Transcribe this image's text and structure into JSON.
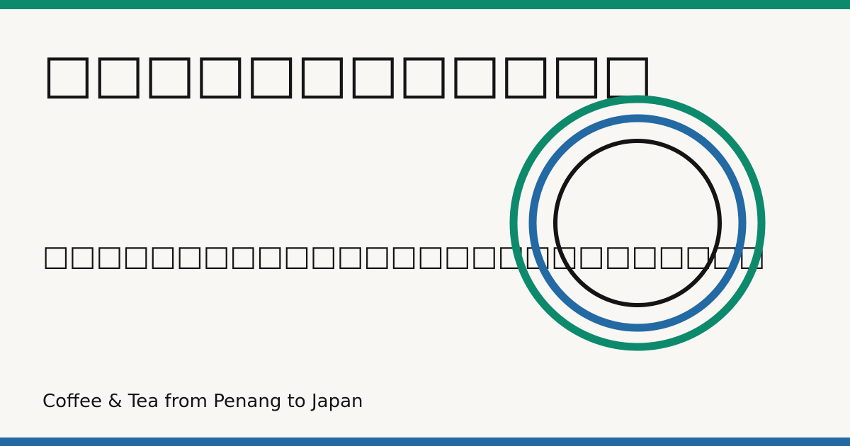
{
  "title": "□□□□□□□□□□□□",
  "subtitle": "□□□□□□□□□□□□□□□□□□□□□□□□□□□",
  "tagline": "Coffee & Tea from Penang to Japan",
  "colors": {
    "background": "#f9f7f3",
    "green": "#0d8a6c",
    "blue": "#2369a3",
    "ink": "#141414"
  }
}
